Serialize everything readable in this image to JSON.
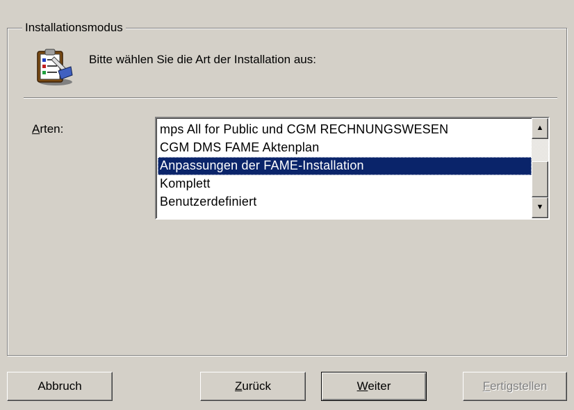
{
  "group": {
    "title": "Installationsmodus"
  },
  "header": {
    "icon": "setup-clipboard-icon",
    "text": "Bitte wählen Sie die Art der Installation aus:"
  },
  "types": {
    "label_mnemonic": "A",
    "label_rest": "rten:",
    "items": [
      "mps All for Public und CGM RECHNUNGSWESEN",
      "CGM DMS FAME Aktenplan",
      "Anpassungen der FAME-Installation",
      "Komplett",
      "Benutzerdefiniert"
    ],
    "selected_index": 2
  },
  "scrollbar": {
    "up_icon": "scroll-up-arrow-icon",
    "down_icon": "scroll-down-arrow-icon"
  },
  "buttons": {
    "cancel": "Abbruch",
    "back_mnemonic": "Z",
    "back_rest": "urück",
    "next_mnemonic": "W",
    "next_rest": "eiter",
    "finish_mnemonic": "F",
    "finish_rest": "ertigstellen"
  }
}
